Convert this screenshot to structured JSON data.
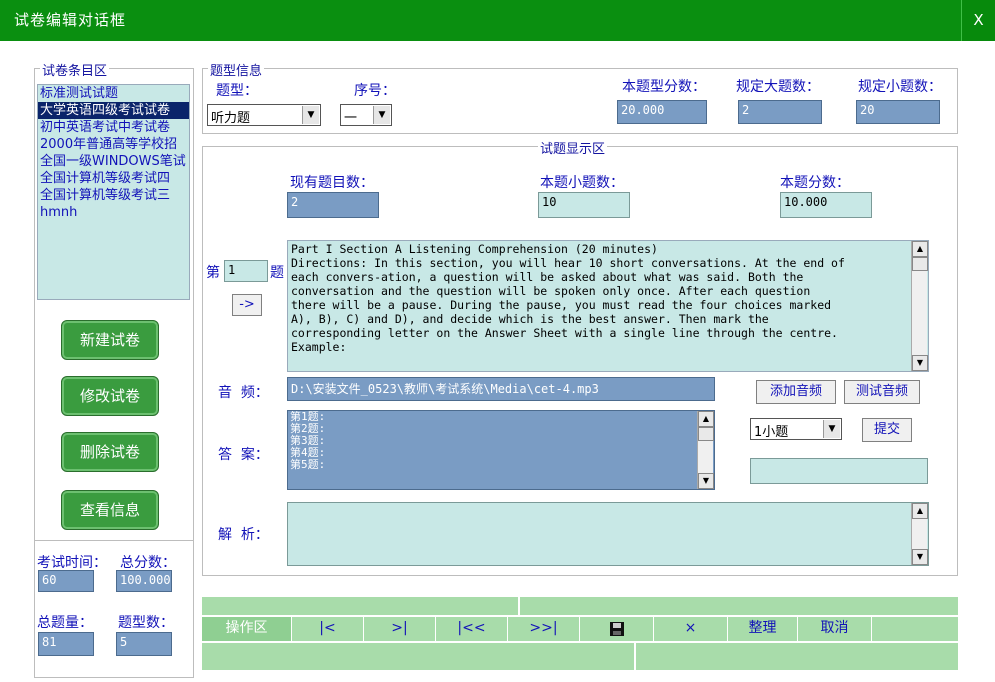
{
  "window": {
    "title": "试卷编辑对话框",
    "close_label": "X"
  },
  "left": {
    "group_label": "试卷条目区",
    "items": [
      "标准测试试题",
      "大学英语四级考试试卷",
      "初中英语考试中考试卷",
      "2000年普通高等学校招",
      "全国一级WINDOWS笔试",
      "全国计算机等级考试四",
      "全国计算机等级考试三",
      "hmnh"
    ],
    "selected_index": 1,
    "buttons": [
      "新建试卷",
      "修改试卷",
      "删除试卷",
      "查看信息"
    ],
    "exam_time_label": "考试时间：",
    "exam_time_value": "60",
    "total_score_label": "总分数：",
    "total_score_value": "100.000",
    "total_questions_label": "总题量：",
    "total_questions_value": "81",
    "type_count_label": "题型数：",
    "type_count_value": "5"
  },
  "type_info": {
    "group_label": "题型信息",
    "type_label": "题型：",
    "type_value": "听力题",
    "seq_label": "序号：",
    "seq_value": "一",
    "score_label": "本题型分数：",
    "score_value": "20.000",
    "major_label": "规定大题数：",
    "major_value": "2",
    "minor_label": "规定小题数：",
    "minor_value": "20"
  },
  "display": {
    "group_label": "试题显示区",
    "existing_label": "现有题目数：",
    "existing_value": "2",
    "sub_label": "本题小题数：",
    "sub_value": "10",
    "qscore_label": "本题分数：",
    "qscore_value": "10.000",
    "nav_prefix": "第",
    "nav_value": "1",
    "nav_suffix": "题",
    "go_label": "->",
    "content": "Part I Section A Listening Comprehension (20 minutes)\nDirections: In this section, you will hear 10 short conversations. At the end of\neach convers-ation, a question will be asked about what was said. Both the\nconversation and the question will be spoken only once. After each question\nthere will be a pause. During the pause, you must read the four choices marked\nA), B), C) and D), and decide which is the best answer. Then mark the\ncorresponding letter on the Answer Sheet with a single line through the centre.\nExample:",
    "audio_label": "音  频：",
    "audio_value": "D:\\安装文件_0523\\教师\\考试系统\\Media\\cet-4.mp3",
    "add_audio": "添加音频",
    "test_audio": "测试音频",
    "answer_label": "答  案：",
    "answers": [
      "第1题:",
      "第2题:",
      "第3题:",
      "第4题:",
      "第5题:"
    ],
    "sub_select": "1小题",
    "submit": "提交",
    "analysis_label": "解  析："
  },
  "toolbar": {
    "label": "操作区",
    "first": "|<",
    "next": ">|",
    "prev_page": "|<<",
    "last": ">>|",
    "delete": "×",
    "organize": "整理",
    "cancel": "取消"
  }
}
